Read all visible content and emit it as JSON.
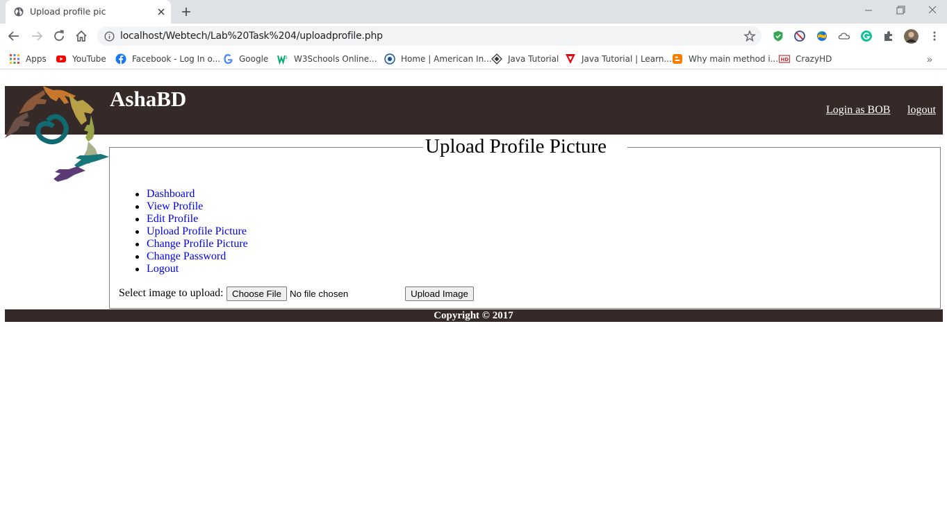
{
  "browser": {
    "tab_title": "Upload profile pic",
    "url": "localhost/Webtech/Lab%20Task%204/uploadprofile.php",
    "bookmarks": [
      {
        "label": "Apps",
        "icon": "apps-grid-icon"
      },
      {
        "label": "YouTube",
        "icon": "youtube-icon"
      },
      {
        "label": "Facebook - Log In o...",
        "icon": "facebook-icon"
      },
      {
        "label": "Google",
        "icon": "google-icon"
      },
      {
        "label": "W3Schools Online...",
        "icon": "w3schools-icon"
      },
      {
        "label": "Home | American In...",
        "icon": "aiub-icon"
      },
      {
        "label": "Java Tutorial",
        "icon": "java-diamond-icon"
      },
      {
        "label": "Java Tutorial | Learn...",
        "icon": "java-triangle-icon"
      },
      {
        "label": "Why main method i...",
        "icon": "blogger-icon"
      },
      {
        "label": "CrazyHD",
        "icon": "hd-icon"
      }
    ],
    "more_bookmarks": "»"
  },
  "header": {
    "site_title": "AshaBD",
    "login_link": "Login as BOB",
    "logout_link": "logout"
  },
  "main": {
    "legend": "Upload Profile Picture",
    "menu": [
      "Dashboard",
      "View Profile",
      "Edit Profile",
      "Upload Profile Picture",
      "Change Profile Picture",
      "Change Password",
      "Logout"
    ],
    "upload_label": "Select image to upload:",
    "choose_file_label": "Choose File",
    "no_file_text": "No file chosen",
    "upload_button_label": "Upload Image"
  },
  "footer": {
    "copyright": "Copyright © 2017"
  },
  "colors": {
    "header_bg": "#362a29",
    "link": "#0000ee",
    "chrome_bg": "#dee1e6"
  }
}
